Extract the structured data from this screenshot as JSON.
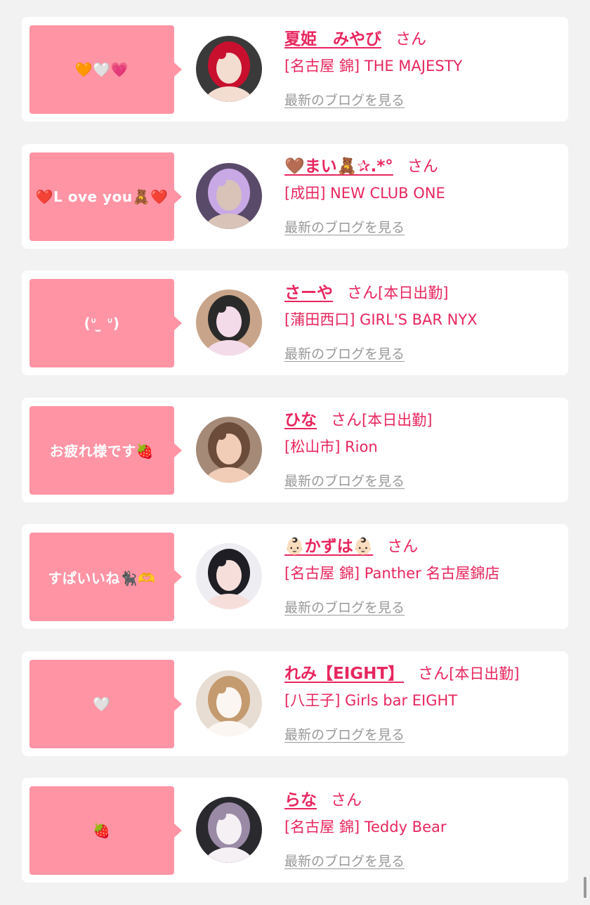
{
  "cards": [
    {
      "bubble": "🧡🤍💗",
      "name": "夏姫　みやび",
      "san": "さん",
      "status": "",
      "shop": "[名古屋 錦] THE MAJESTY",
      "blog_link": "最新のブログを見る",
      "avatar": {
        "bg": "#3a3a3a",
        "skin": "#f3ddd1",
        "accent": "#c8102e"
      }
    },
    {
      "bubble": "❤️L ove you🧸❤️",
      "name": "🤎まい🧸✰.*°",
      "san": "さん",
      "status": "",
      "shop": "[成田] NEW CLUB ONE",
      "blog_link": "最新のブログを見る",
      "avatar": {
        "bg": "#5a4a6a",
        "skin": "#d9c3b8",
        "accent": "#c9a8e6"
      }
    },
    {
      "bubble": "(ᐡ ̫ ᐡ)",
      "name": "さーや",
      "san": "さん",
      "status": "[本日出勤]",
      "shop": "[蒲田西口] GIRL'S BAR NYX",
      "blog_link": "最新のブログを見る",
      "avatar": {
        "bg": "#c8a58a",
        "skin": "#f4dbea",
        "accent": "#2a2a2a"
      }
    },
    {
      "bubble": "お疲れ様です🍓",
      "name": "ひな",
      "san": "さん",
      "status": "[本日出勤]",
      "shop": "[松山市] Rion",
      "blog_link": "最新のブログを見る",
      "avatar": {
        "bg": "#a58a78",
        "skin": "#f1cdb7",
        "accent": "#6b4b3a"
      }
    },
    {
      "bubble": "すぱいいね🐈‍⬛🫶",
      "name": "👶🏻かずは👶🏻",
      "san": "さん",
      "status": "",
      "shop": "[名古屋 錦] Panther 名古屋錦店",
      "blog_link": "最新のブログを見る",
      "avatar": {
        "bg": "#ededf2",
        "skin": "#f6dfdb",
        "accent": "#1e1e24"
      }
    },
    {
      "bubble": "🤍",
      "name": "れみ【EIGHT】",
      "san": "さん",
      "status": "[本日出勤]",
      "shop": "[八王子] Girls bar EIGHT",
      "blog_link": "最新のブログを見る",
      "avatar": {
        "bg": "#e8ddd3",
        "skin": "#fbf6f2",
        "accent": "#c49a6f"
      }
    },
    {
      "bubble": "🍓",
      "name": "らな",
      "san": "さん",
      "status": "",
      "shop": "[名古屋 錦] Teddy Bear",
      "blog_link": "最新のブログを見る",
      "avatar": {
        "bg": "#2a2a2e",
        "skin": "#f4f0f4",
        "accent": "#9a8aa6"
      }
    }
  ]
}
